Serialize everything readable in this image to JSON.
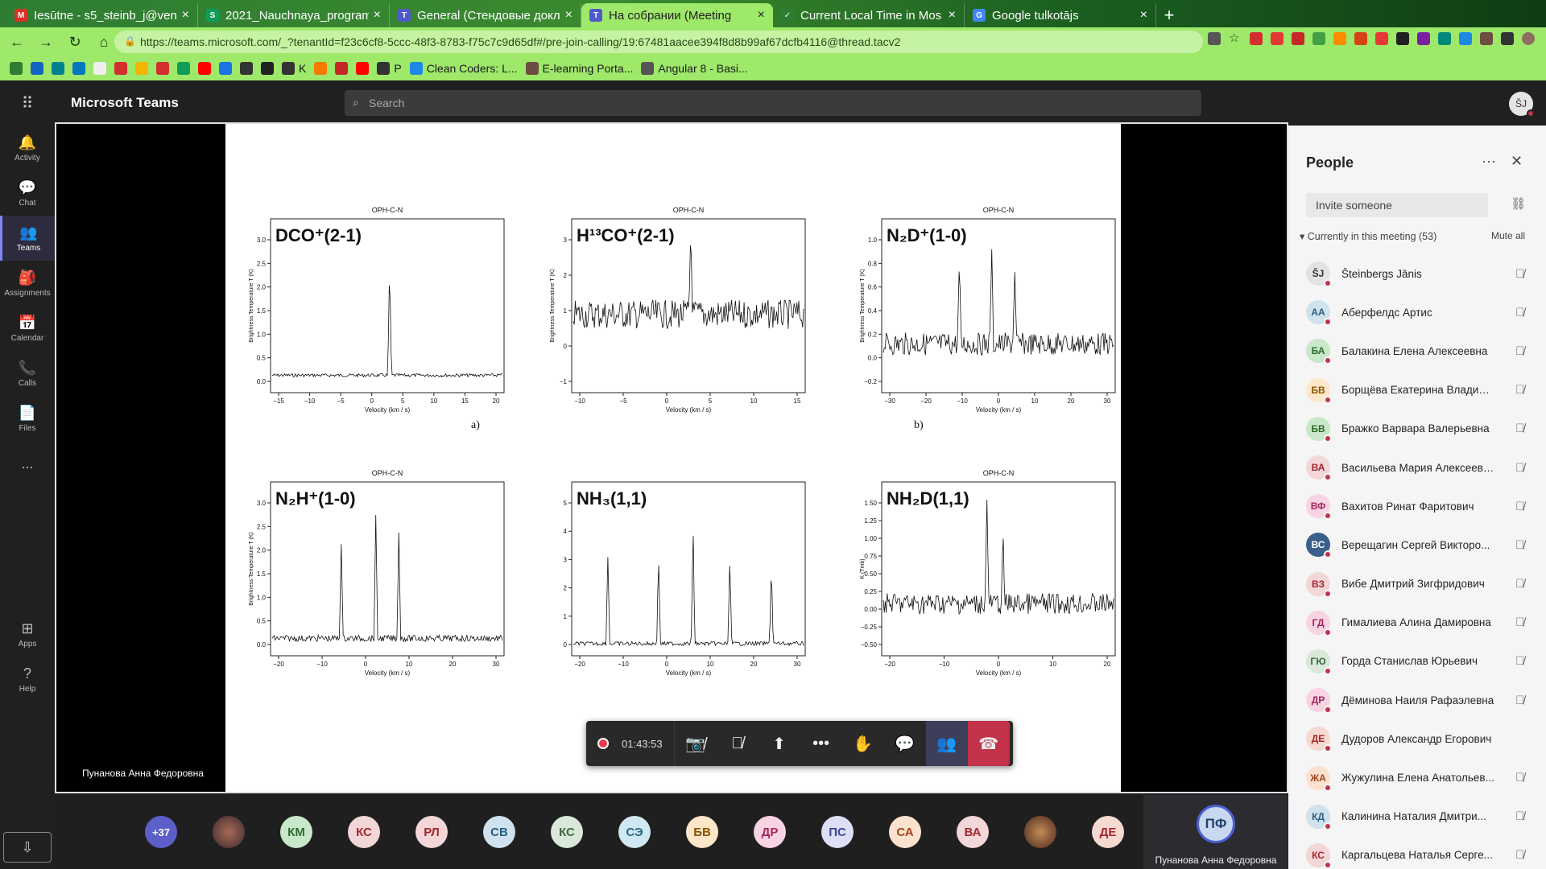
{
  "browser": {
    "tabs": [
      {
        "title": "Iesūtne - s5_steinb_j@ven",
        "color": "#d93025",
        "glyph": "M"
      },
      {
        "title": "2021_Nauchnaya_program",
        "color": "#0f9d58",
        "glyph": "S"
      },
      {
        "title": "General (Стендовые докл",
        "color": "#5059c9",
        "glyph": "T"
      },
      {
        "title": "На собрании (Meeting",
        "color": "#5059c9",
        "glyph": "T"
      },
      {
        "title": "Current Local Time in Mos",
        "color": "#2e7d32",
        "glyph": "✓"
      },
      {
        "title": "Google tulkotājs",
        "color": "#4285f4",
        "glyph": "G"
      }
    ],
    "url": "https://teams.microsoft.com/_?tenantId=f23c6cf8-5ccc-48f3-8783-f75c7c9d65df#/pre-join-calling/19:67481aacee394f8d8b99af67dcfb4116@thread.tacv2",
    "bookmarks": [
      "K",
      "P",
      "Clean Coders: L...",
      "E-learning Porta...",
      "Angular 8 - Basi..."
    ]
  },
  "teams": {
    "app_name": "Microsoft Teams",
    "search_placeholder": "Search",
    "me_initials": "ŠJ",
    "rail": [
      {
        "label": "Activity",
        "icon": "bell-icon",
        "glyph": "🔔"
      },
      {
        "label": "Chat",
        "icon": "chat-icon",
        "glyph": "💬"
      },
      {
        "label": "Teams",
        "icon": "teams-icon",
        "glyph": "👥"
      },
      {
        "label": "Assignments",
        "icon": "assignments-icon",
        "glyph": "🎒"
      },
      {
        "label": "Calendar",
        "icon": "calendar-icon",
        "glyph": "📅"
      },
      {
        "label": "Calls",
        "icon": "phone-icon",
        "glyph": "📞"
      },
      {
        "label": "Files",
        "icon": "file-icon",
        "glyph": "📄"
      }
    ],
    "rail_more": "...",
    "apps_label": "Apps",
    "help_label": "Help"
  },
  "meeting": {
    "timer": "01:43:53",
    "presenter": "Пунанова Анна Федоровна",
    "overflow_count": "+37",
    "strip": [
      {
        "initials": "КМ",
        "bg": "#c9e7c9",
        "fg": "#2d6b2d"
      },
      {
        "initials": "КС",
        "bg": "#f3d6d8",
        "fg": "#a4262c"
      },
      {
        "initials": "РЛ",
        "bg": "#f3d6d8",
        "fg": "#a4262c"
      },
      {
        "initials": "СВ",
        "bg": "#cfe2ee",
        "fg": "#2a5f80"
      },
      {
        "initials": "КС",
        "bg": "#d9e8d9",
        "fg": "#3d6b3d"
      },
      {
        "initials": "СЭ",
        "bg": "#cfe8f3",
        "fg": "#23697f"
      },
      {
        "initials": "БВ",
        "bg": "#fde7c8",
        "fg": "#8a5300"
      },
      {
        "initials": "ДР",
        "bg": "#f8d3e3",
        "fg": "#a4265f"
      },
      {
        "initials": "ПС",
        "bg": "#dcdff5",
        "fg": "#3b4799"
      },
      {
        "initials": "СА",
        "bg": "#fde1cf",
        "fg": "#a0451c"
      },
      {
        "initials": "ВА",
        "bg": "#f3d6d8",
        "fg": "#a4262c"
      },
      {
        "initials": "ДЕ",
        "bg": "#f6d9d0",
        "fg": "#a4262c"
      }
    ],
    "presenter_tile_initials": "ПФ"
  },
  "people_panel": {
    "title": "People",
    "invite_placeholder": "Invite someone",
    "currently_label": "Currently in this meeting (53)",
    "mute_all": "Mute all",
    "participants": [
      {
        "initials": "ŠJ",
        "name": "Šteinbergs Jānis",
        "bg": "#e3e3e3",
        "fg": "#333"
      },
      {
        "initials": "АА",
        "name": "Аберфелдс Артис",
        "bg": "#cfe2ee",
        "fg": "#2a5f80"
      },
      {
        "initials": "БА",
        "name": "Балакина Елена Алексеевна",
        "bg": "#c9e7c9",
        "fg": "#2d6b2d"
      },
      {
        "initials": "БВ",
        "name": "Борщёва Екатерина Владим...",
        "bg": "#fde7c8",
        "fg": "#8a5300"
      },
      {
        "initials": "БВ",
        "name": "Бражко Варвара Валерьевна",
        "bg": "#c9e7c9",
        "fg": "#2d6b2d"
      },
      {
        "initials": "ВА",
        "name": "Васильева Мария Алексеевна",
        "bg": "#f3d6d8",
        "fg": "#a4262c"
      },
      {
        "initials": "ВФ",
        "name": "Вахитов Ринат Фаритович",
        "bg": "#f8d3e3",
        "fg": "#a4265f"
      },
      {
        "initials": "ВС",
        "name": "Верещагин Сергей Викторо...",
        "bg": "#3a5f8a",
        "fg": "#fff"
      },
      {
        "initials": "ВЗ",
        "name": "Вибе Дмитрий Зигфридович",
        "bg": "#f3d6d8",
        "fg": "#a4262c"
      },
      {
        "initials": "ГД",
        "name": "Гималиева Алина Дамировна",
        "bg": "#f8d3e3",
        "fg": "#a4265f"
      },
      {
        "initials": "ГЮ",
        "name": "Горда Станислав Юрьевич",
        "bg": "#d9e8d9",
        "fg": "#3d6b3d"
      },
      {
        "initials": "ДР",
        "name": "Дёминова Наиля Рафаэлевна",
        "bg": "#f8d3e3",
        "fg": "#a4265f"
      },
      {
        "initials": "ДЕ",
        "name": "Дудоров Александр Егорович",
        "bg": "#f6d9d0",
        "fg": "#a4262c"
      },
      {
        "initials": "ЖА",
        "name": "Жужулина Елена Анатольев...",
        "bg": "#fde1cf",
        "fg": "#a0451c"
      },
      {
        "initials": "КД",
        "name": "Калинина Наталия Дмитри...",
        "bg": "#cfe2ee",
        "fg": "#2a5f80"
      },
      {
        "initials": "КС",
        "name": "Каргальцева Наталья Серге...",
        "bg": "#f3d6d8",
        "fg": "#a4262c"
      }
    ]
  },
  "slide": {
    "panels": [
      {
        "sup": "OPH-C-N",
        "label": "DCO⁺(2-1)",
        "ylabel": "Brightness Temperature T (K)",
        "xlabel": "Velocity (km / s)",
        "xticks": [
          "−15",
          "−10",
          "−5",
          "0",
          "5",
          "10",
          "15",
          "20"
        ],
        "yticks": [
          "0.0",
          "0.5",
          "1.0",
          "1.5",
          "2.0",
          "2.5",
          "3.0"
        ]
      },
      {
        "sup": "OPH-C-N",
        "label": "H¹³CO⁺(2-1)",
        "ylabel": "Brightness Temperature T (K)",
        "xlabel": "Velocity (km / s)",
        "xticks": [
          "−10",
          "−5",
          "0",
          "5",
          "10",
          "15"
        ],
        "yticks": [
          "−1",
          "0",
          "1",
          "2",
          "3"
        ]
      },
      {
        "sup": "OPH-C-N",
        "label": "N₂D⁺(1-0)",
        "ylabel": "Brightness Temperature T (K)",
        "xlabel": "Velocity (km / s)",
        "xticks": [
          "−30",
          "−20",
          "−10",
          "0",
          "10",
          "20",
          "30"
        ],
        "yticks": [
          "−0.2",
          "0.0",
          "0.2",
          "0.4",
          "0.6",
          "0.8",
          "1.0"
        ]
      },
      {
        "sup": "OPH-C-N",
        "label": "N₂H⁺(1-0)",
        "ylabel": "Brightness Temperature T (K)",
        "xlabel": "Velocity (km / s)",
        "xticks": [
          "−20",
          "−10",
          "0",
          "10",
          "20",
          "30"
        ],
        "yticks": [
          "0.0",
          "0.5",
          "1.0",
          "1.5",
          "2.0",
          "2.5",
          "3.0"
        ]
      },
      {
        "sup": "",
        "label": "NH₃(1,1)",
        "ylabel": "",
        "xlabel": "Velocity (km / s)",
        "xticks": [
          "−20",
          "−10",
          "0",
          "10",
          "20",
          "30"
        ],
        "yticks": [
          "0",
          "1",
          "2",
          "3",
          "4",
          "5"
        ]
      },
      {
        "sup": "OPH-C-N",
        "label": "NH₂D(1,1)",
        "ylabel": "K (Tmb)",
        "xlabel": "Velocity (km / s)",
        "xticks": [
          "−20",
          "−10",
          "0",
          "10",
          "20"
        ],
        "yticks": [
          "−0.50",
          "−0.25",
          "0.00",
          "0.25",
          "0.50",
          "0.75",
          "1.00",
          "1.25",
          "1.50"
        ]
      }
    ],
    "captions": [
      "a)",
      "b)"
    ]
  }
}
